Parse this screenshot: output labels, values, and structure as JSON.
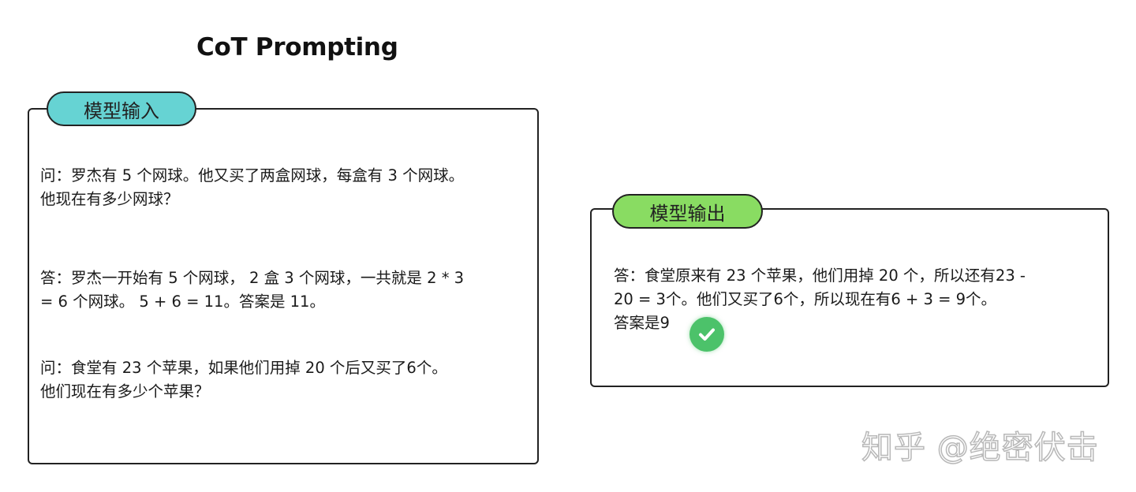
{
  "title": "CoT Prompting",
  "input_panel": {
    "tag": "模型输入",
    "question1": {
      "line1": "问：罗杰有 5 个网球。他又买了两盒网球，每盒有 3 个网球。",
      "line2": "他现在有多少网球？"
    },
    "answer1": {
      "line1": "答：罗杰一开始有 5 个网球， 2 盒 3 个网球，一共就是 2 * 3",
      "line2": "= 6 个网球。 5 + 6 = 11。答案是 11。"
    },
    "question2": {
      "line1": "问：食堂有 23 个苹果，如果他们用掉 20 个后又买了6个。",
      "line2": "他们现在有多少个苹果？"
    }
  },
  "output_panel": {
    "tag": "模型输出",
    "answer": {
      "line1": "答：食堂原来有 23 个苹果，他们用掉 20 个，所以还有23 -",
      "line2": "20 = 3个。他们又买了6个，所以现在有6 + 3 = 9个。",
      "line3": "答案是9"
    },
    "check_icon": "check-circle-icon",
    "check_color": "#4cc26a"
  },
  "colors": {
    "input_tag": "#66d3d3",
    "output_tag": "#89dc62"
  },
  "watermark": "知乎 @绝密伏击"
}
